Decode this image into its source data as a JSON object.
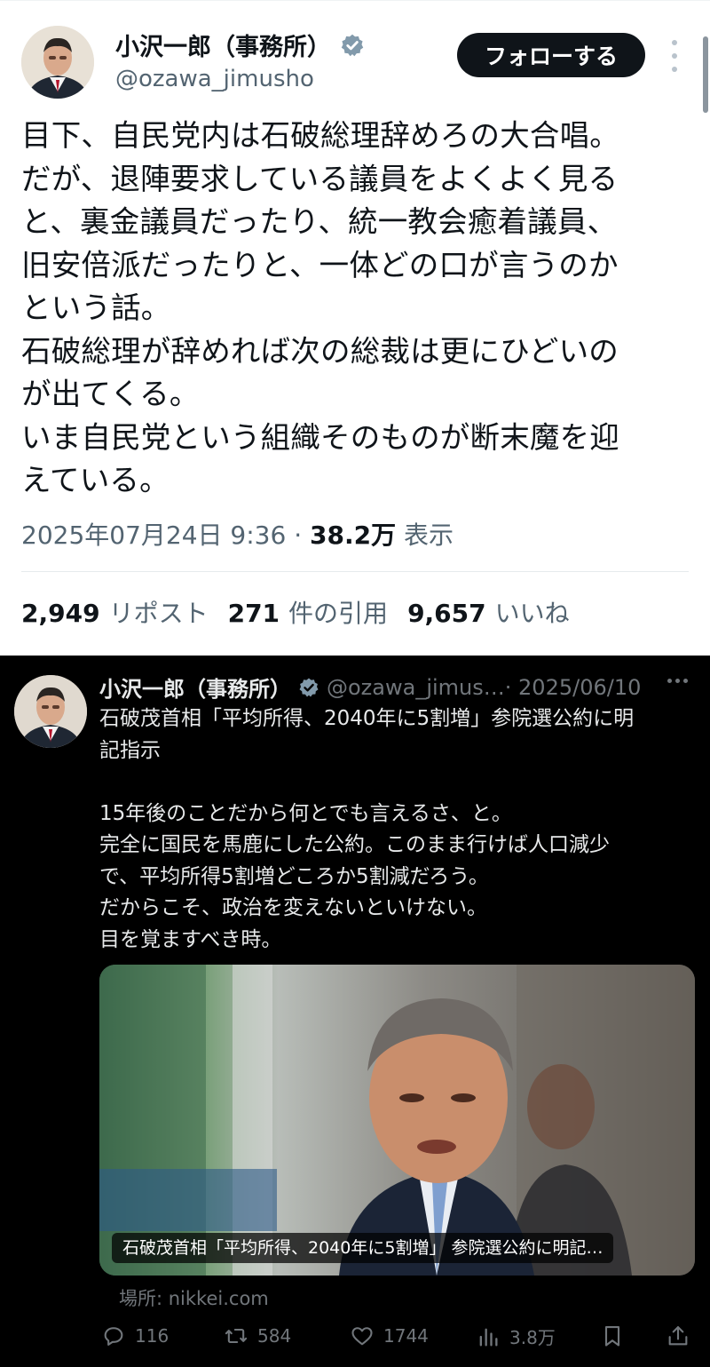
{
  "tweet": {
    "author_name": "小沢一郎（事務所）",
    "author_handle": "@ozawa_jimusho",
    "follow_label": "フォローする",
    "body": "目下、自民党内は石破総理辞めろの大合唱。\nだが、退陣要求している議員をよくよく見る\nと、裏金議員だったり、統一教会癒着議員、\n旧安倍派だったりと、一体どの口が言うのか\nという話。\n石破総理が辞めれば次の総裁は更にひどいの\nが出てくる。\nいま自民党という組織そのものが断末魔を迎\nえている。",
    "date_time": "2025年07月24日 9:36",
    "separator": " · ",
    "views_count": "38.2万",
    "views_label": " 表示",
    "stats": {
      "reposts_count": "2,949",
      "reposts_label": "リポスト",
      "quotes_count": "271",
      "quotes_label": "件の引用",
      "likes_count": "9,657",
      "likes_label": "いいね"
    }
  },
  "quoted": {
    "author_name": "小沢一郎（事務所）",
    "author_handle": "@ozawa_jimus…",
    "date": "· 2025/06/10",
    "body": "石破茂首相「平均所得、2040年に5割増」参院選公約に明\n記指示\n\n15年後のことだから何とでも言えるさ、と。\n完全に国民を馬鹿にした公約。このまま行けば人口減少\nで、平均所得5割増どころか5割減だろう。\nだからこそ、政治を変えないといけない。\n目を覚ますべき時。",
    "card_caption": "石破茂首相「平均所得、2040年に5割増」 参院選公約に明記…",
    "source": "場所: nikkei.com",
    "actions": {
      "replies": "116",
      "reposts": "584",
      "likes": "1744",
      "views": "3.8万"
    }
  },
  "colors": {
    "verified": "#829aab",
    "follow_bg": "#0f1419",
    "dark_bg": "#000000",
    "muted": "#536471",
    "dark_muted": "#71767b"
  },
  "icons": [
    "verified-badge-icon",
    "more-icon",
    "reply-icon",
    "repost-icon",
    "like-icon",
    "views-icon",
    "bookmark-icon",
    "share-icon"
  ]
}
